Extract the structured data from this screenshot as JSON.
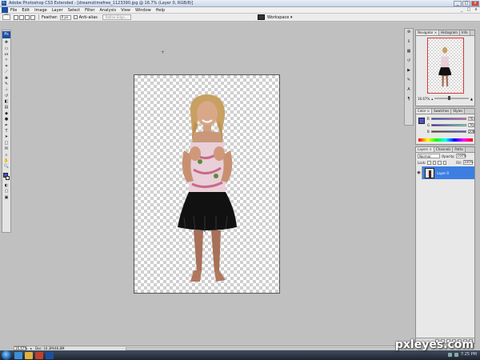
{
  "window": {
    "title": "Adobe Photoshop CS3 Extended - [dreamstimefree_1123390.jpg @ 16.7% (Layer 0, RGB/8)]",
    "app_badge": "Ps",
    "controls": [
      "_",
      "□",
      "x"
    ]
  },
  "menubar": {
    "items": [
      "File",
      "Edit",
      "Image",
      "Layer",
      "Select",
      "Filter",
      "Analysis",
      "View",
      "Window",
      "Help"
    ],
    "controls": [
      "_",
      "□",
      "x"
    ]
  },
  "options_bar": {
    "feather_label": "Feather:",
    "feather_value": "0 px",
    "antialias_label": "Anti-alias",
    "refine_edge_label": "Refine Edge...",
    "workspace_label": "Workspace ▾"
  },
  "toolbox": {
    "logo": "Ps",
    "tools": [
      {
        "name": "move-tool",
        "glyph": "✥"
      },
      {
        "name": "marquee-tool",
        "glyph": "▭"
      },
      {
        "name": "lasso-tool",
        "glyph": "ᔕ"
      },
      {
        "name": "magic-wand-tool",
        "glyph": "✧"
      },
      {
        "name": "crop-tool",
        "glyph": "⌗"
      },
      {
        "name": "slice-tool",
        "glyph": "⟋"
      },
      {
        "name": "healing-brush-tool",
        "glyph": "✚"
      },
      {
        "name": "brush-tool",
        "glyph": "✎"
      },
      {
        "name": "clone-stamp-tool",
        "glyph": "⊥"
      },
      {
        "name": "history-brush-tool",
        "glyph": "↺"
      },
      {
        "name": "eraser-tool",
        "glyph": "◧"
      },
      {
        "name": "gradient-tool",
        "glyph": "▤"
      },
      {
        "name": "blur-tool",
        "glyph": "◆"
      },
      {
        "name": "dodge-tool",
        "glyph": "●"
      },
      {
        "name": "pen-tool",
        "glyph": "✒"
      },
      {
        "name": "type-tool",
        "glyph": "T"
      },
      {
        "name": "path-selection-tool",
        "glyph": "➤"
      },
      {
        "name": "shape-tool",
        "glyph": "□"
      },
      {
        "name": "notes-tool",
        "glyph": "✉"
      },
      {
        "name": "eyedropper-tool",
        "glyph": "⌕"
      },
      {
        "name": "hand-tool",
        "glyph": "✋"
      },
      {
        "name": "zoom-tool",
        "glyph": "🔍"
      }
    ],
    "mode_glyphs": [
      "◐",
      "▢",
      "▣"
    ],
    "foreground_color": "#5050cc",
    "background_color": "#ffffff"
  },
  "dock_strip": {
    "items": [
      {
        "name": "navigator-icon",
        "glyph": "⊕"
      },
      {
        "name": "info-icon",
        "glyph": "ℹ"
      },
      {
        "name": "swatches-icon",
        "glyph": "▦"
      },
      {
        "name": "history-icon",
        "glyph": "↺"
      },
      {
        "name": "actions-icon",
        "glyph": "▶"
      },
      {
        "name": "brushes-icon",
        "glyph": "✎"
      },
      {
        "name": "character-icon",
        "glyph": "A"
      },
      {
        "name": "paragraph-icon",
        "glyph": "¶"
      }
    ]
  },
  "navigator": {
    "tabs": [
      "Navigator ×",
      "Histogram",
      "Info"
    ],
    "zoom": "16.67%",
    "minus": "▴",
    "plus": "▲",
    "slider_position": 0.4
  },
  "color_panel": {
    "tabs": [
      "Color ×",
      "Swatches",
      "Styles"
    ],
    "channels": [
      {
        "label": "R",
        "value": "76",
        "gradient": "linear-gradient(90deg,#0050cc,#ff50cc)"
      },
      {
        "label": "G",
        "value": "76",
        "gradient": "linear-gradient(90deg,#5000cc,#50ffcc)"
      },
      {
        "label": "B",
        "value": "206",
        "gradient": "linear-gradient(90deg,#505000,#5050ff)"
      }
    ],
    "swatch_color": "#5050cc"
  },
  "layers_panel": {
    "tabs": [
      "Layers ×",
      "Channels",
      "Paths"
    ],
    "blend_mode": "Normal",
    "opacity_label": "Opacity:",
    "opacity_value": "100%",
    "lock_label": "Lock:",
    "fill_label": "Fill:",
    "fill_value": "100%",
    "layers": [
      {
        "name": "Layer 0",
        "visible_glyph": "◉"
      }
    ]
  },
  "statusbar": {
    "zoom": "16.67%",
    "doc": "Doc: 16.3M/46.8M"
  },
  "taskbar": {
    "clock": "7:25 PM"
  },
  "watermark": "pxleyes.com"
}
